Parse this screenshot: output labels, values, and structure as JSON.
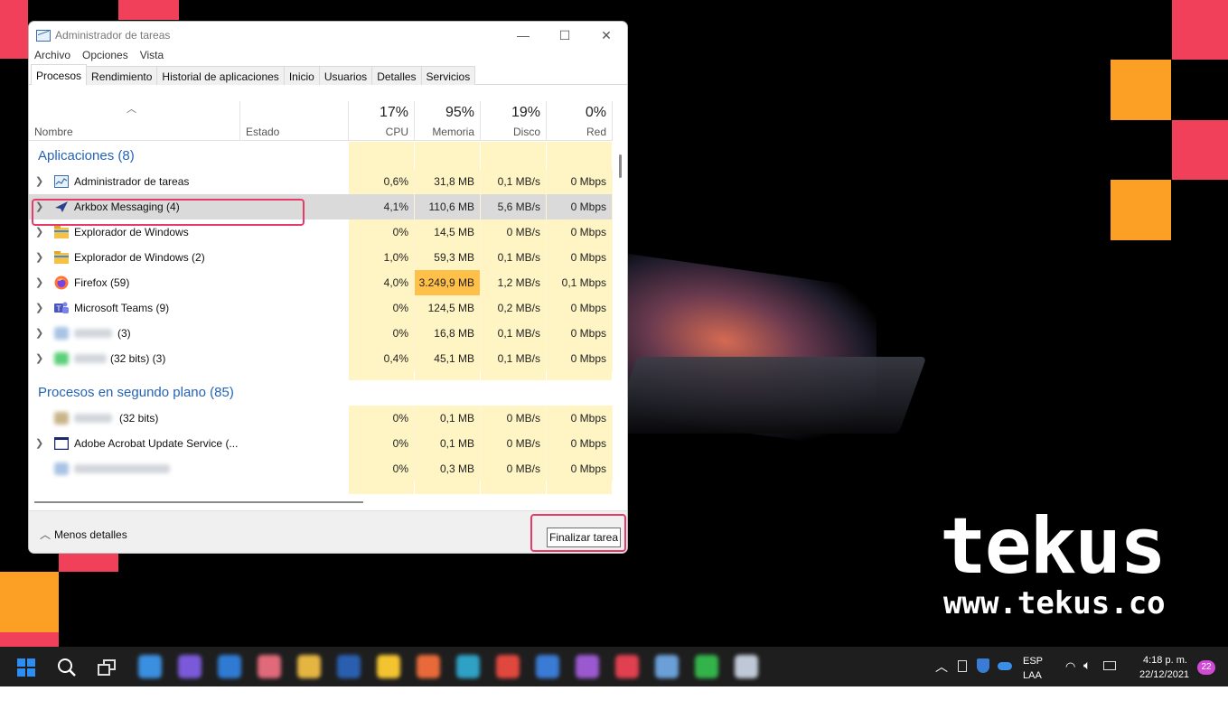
{
  "window": {
    "title": "Administrador de tareas",
    "minimize_glyph": "—",
    "maximize_glyph": "☐",
    "close_glyph": "✕"
  },
  "menu": [
    "Archivo",
    "Opciones",
    "Vista"
  ],
  "tabs": [
    "Procesos",
    "Rendimiento",
    "Historial de aplicaciones",
    "Inicio",
    "Usuarios",
    "Detalles",
    "Servicios"
  ],
  "columns": {
    "name": "Nombre",
    "state": "Estado",
    "cpu": {
      "pct": "17%",
      "label": "CPU"
    },
    "memory": {
      "pct": "95%",
      "label": "Memoria"
    },
    "disk": {
      "pct": "19%",
      "label": "Disco"
    },
    "network": {
      "pct": "0%",
      "label": "Red"
    }
  },
  "groups": {
    "apps": "Aplicaciones (8)",
    "background": "Procesos en segundo plano (85)"
  },
  "app_rows": [
    {
      "name": "Administrador de tareas",
      "cpu": "0,6%",
      "mem": "31,8 MB",
      "disk": "0,1 MB/s",
      "net": "0 Mbps",
      "icon": "task-manager-icon"
    },
    {
      "name": "Arkbox Messaging (4)",
      "cpu": "4,1%",
      "mem": "110,6 MB",
      "disk": "5,6 MB/s",
      "net": "0 Mbps",
      "icon": "arkbox-icon"
    },
    {
      "name": "Explorador de Windows",
      "cpu": "0%",
      "mem": "14,5 MB",
      "disk": "0 MB/s",
      "net": "0 Mbps",
      "icon": "folder-icon"
    },
    {
      "name": "Explorador de Windows (2)",
      "cpu": "1,0%",
      "mem": "59,3 MB",
      "disk": "0,1 MB/s",
      "net": "0 Mbps",
      "icon": "folder-icon"
    },
    {
      "name": "Firefox (59)",
      "cpu": "4,0%",
      "mem": "3.249,9 MB",
      "disk": "1,2 MB/s",
      "net": "0,1 Mbps",
      "icon": "firefox-icon"
    },
    {
      "name": "Microsoft Teams (9)",
      "cpu": "0%",
      "mem": "124,5 MB",
      "disk": "0,2 MB/s",
      "net": "0 Mbps",
      "icon": "teams-icon"
    },
    {
      "name": "(3)",
      "cpu": "0%",
      "mem": "16,8 MB",
      "disk": "0,1 MB/s",
      "net": "0 Mbps",
      "icon": "blurred-app-icon"
    },
    {
      "name": "(32 bits) (3)",
      "cpu": "0,4%",
      "mem": "45,1 MB",
      "disk": "0,1 MB/s",
      "net": "0 Mbps",
      "icon": "blurred-app-icon"
    }
  ],
  "bg_rows": [
    {
      "name": "(32 bits)",
      "cpu": "0%",
      "mem": "0,1 MB",
      "disk": "0 MB/s",
      "net": "0 Mbps"
    },
    {
      "name": "Adobe Acrobat Update Service (...",
      "cpu": "0%",
      "mem": "0,1 MB",
      "disk": "0 MB/s",
      "net": "0 Mbps"
    },
    {
      "name": "",
      "cpu": "0%",
      "mem": "0,3 MB",
      "disk": "0 MB/s",
      "net": "0 Mbps"
    }
  ],
  "footer": {
    "less_details": "Menos detalles",
    "end_task": "Finalizar tarea"
  },
  "brand": {
    "name": "tekus",
    "url": "www.tekus.co"
  },
  "taskbar": {
    "lang_top": "ESP",
    "lang_bottom": "LAA",
    "time": "4:18 p. m.",
    "date": "22/12/2021",
    "notifications": "22"
  },
  "colors": {
    "accent_pink": "#f0405a",
    "accent_orange": "#fb9f25",
    "group_blue": "#2563b8",
    "highlight_border": "#e83a67",
    "heat_low": "#fff4c4",
    "heat_high": "#ffc04a"
  }
}
